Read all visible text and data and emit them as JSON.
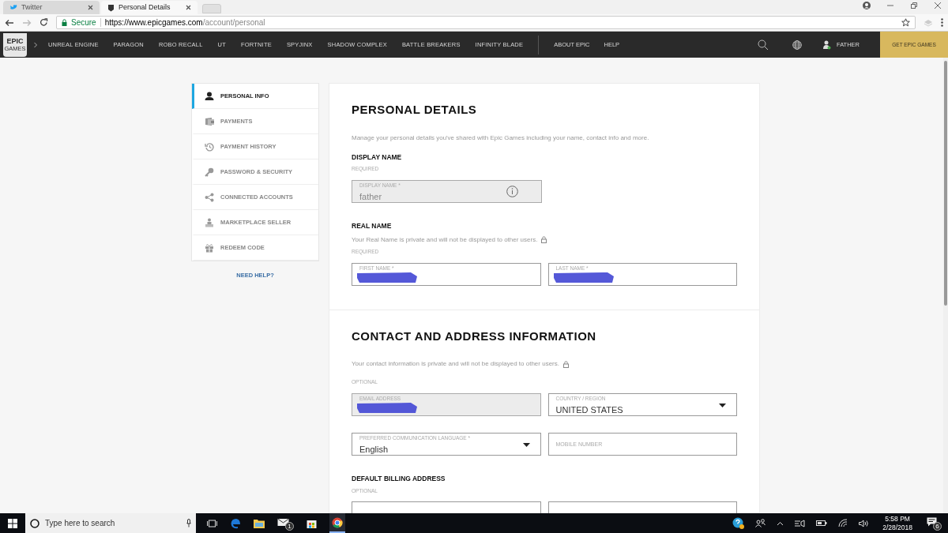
{
  "browser": {
    "tabs": [
      {
        "title": "Twitter",
        "selected": false
      },
      {
        "title": "Personal Details",
        "selected": true
      }
    ],
    "address": {
      "secure_label": "Secure",
      "host": "https://www.epicgames.com",
      "path": "/account/personal"
    }
  },
  "nav": {
    "logo": "EPIC",
    "logo_sub": "GAMES",
    "items": [
      "UNREAL ENGINE",
      "PARAGON",
      "ROBO RECALL",
      "UT",
      "FORTNITE",
      "SPYJINX",
      "SHADOW COMPLEX",
      "BATTLE BREAKERS",
      "INFINITY BLADE"
    ],
    "secondary": [
      "ABOUT EPIC",
      "HELP"
    ],
    "user": "FATHER",
    "cta": "GET EPIC GAMES"
  },
  "sidebar": {
    "items": [
      {
        "label": "PERSONAL INFO",
        "selected": true
      },
      {
        "label": "PAYMENTS",
        "selected": false
      },
      {
        "label": "PAYMENT HISTORY",
        "selected": false
      },
      {
        "label": "PASSWORD & SECURITY",
        "selected": false
      },
      {
        "label": "CONNECTED ACCOUNTS",
        "selected": false
      },
      {
        "label": "MARKETPLACE SELLER",
        "selected": false
      },
      {
        "label": "REDEEM CODE",
        "selected": false
      }
    ],
    "help": "NEED HELP?"
  },
  "sections": [
    {
      "title": "PERSONAL DETAILS",
      "description": "Manage your personal details you've shared with Epic Games including your name, contact info and more.",
      "lock": false,
      "groups": [
        {
          "heading": "DISPLAY NAME",
          "note": "REQUIRED",
          "rows": [
            [
              {
                "kind": "text",
                "label": "DISPLAY NAME *",
                "value": "father",
                "disabled": true,
                "info": true
              }
            ]
          ]
        },
        {
          "heading": "REAL NAME",
          "subtext": "Your Real Name is private and will not be displayed to other users.",
          "note": "REQUIRED",
          "rows": [
            [
              {
                "kind": "text",
                "label": "FIRST NAME *",
                "disabled": false,
                "redacted": true
              },
              {
                "kind": "text",
                "label": "LAST NAME *",
                "disabled": false,
                "redacted": true
              }
            ]
          ]
        }
      ]
    },
    {
      "title": "CONTACT AND ADDRESS INFORMATION",
      "description": "Your contact information is private and will not be displayed to other users.",
      "lock": true,
      "groups": [
        {
          "note": "OPTIONAL",
          "rows": [
            [
              {
                "kind": "text",
                "label": "EMAIL ADDRESS",
                "disabled": true,
                "redacted": true
              },
              {
                "kind": "select",
                "label": "COUNTRY / REGION",
                "value": "UNITED STATES",
                "disabled": false
              }
            ],
            [
              {
                "kind": "select",
                "label": "PREFERRED COMMUNICATION LANGUAGE *",
                "value": "English",
                "disabled": false
              },
              {
                "kind": "text",
                "placeholder": "MOBILE NUMBER",
                "disabled": false
              }
            ]
          ]
        },
        {
          "heading": "DEFAULT BILLING ADDRESS",
          "note": "OPTIONAL",
          "rows": [
            [
              {
                "kind": "text",
                "disabled": false
              },
              {
                "kind": "text",
                "disabled": false
              }
            ]
          ]
        }
      ]
    }
  ],
  "taskbar": {
    "search_placeholder": "Type here to search",
    "mail_badge": "1",
    "time": "5:58 PM",
    "date": "2/28/2018",
    "notification_count": "6"
  }
}
